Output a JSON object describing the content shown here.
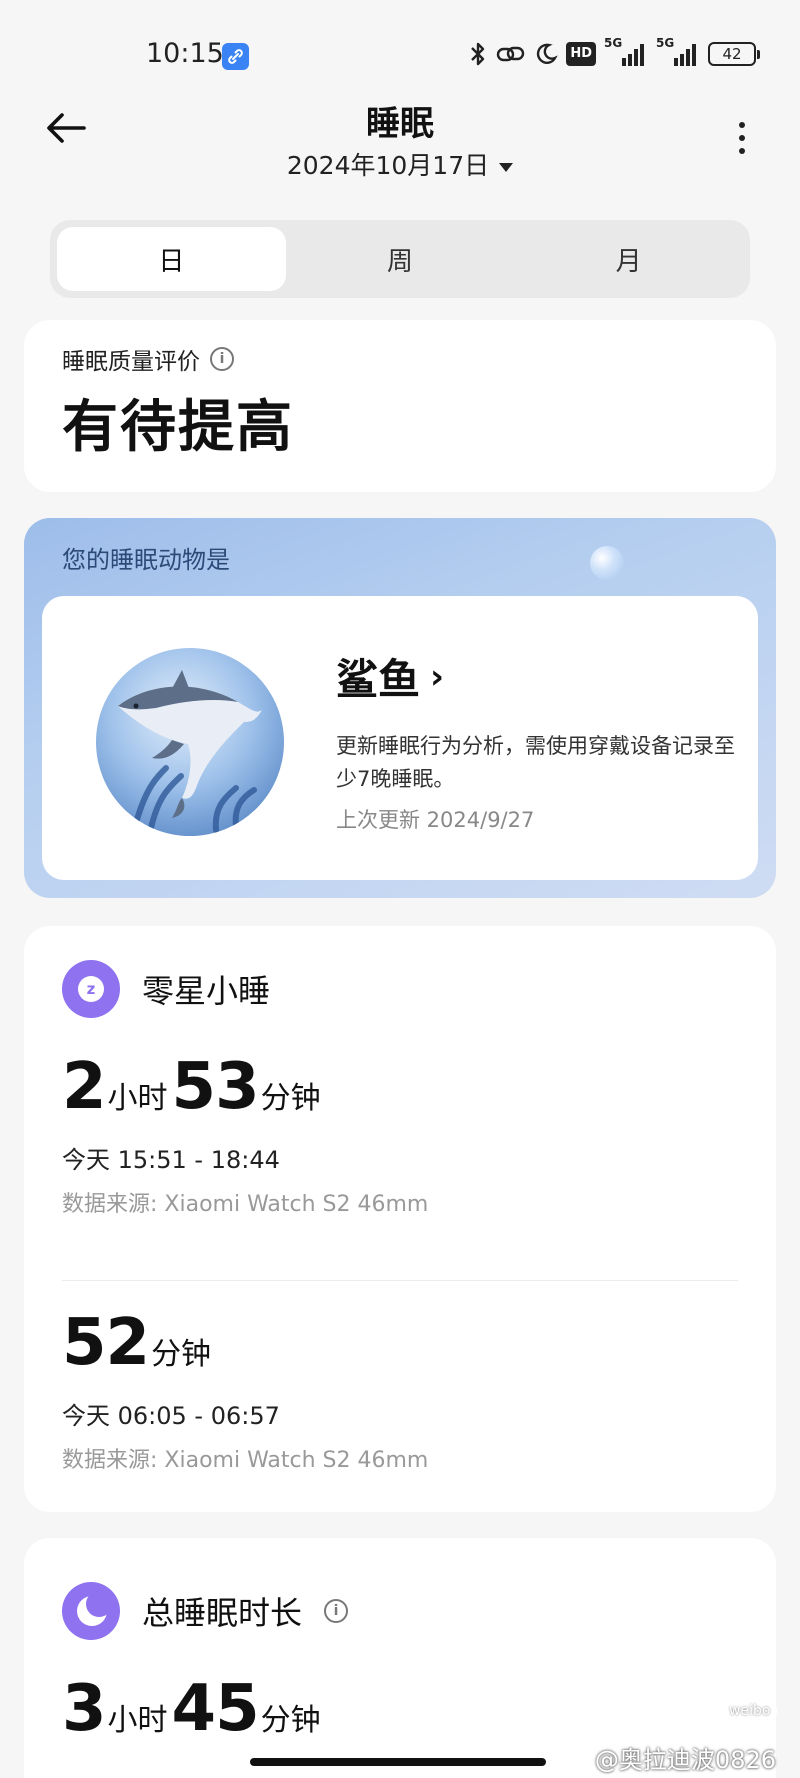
{
  "status_bar": {
    "time": "10:15",
    "hd": "HD",
    "net1": "5G",
    "net2": "5G",
    "battery": "42"
  },
  "header": {
    "title": "睡眠",
    "date": "2024年10月17日"
  },
  "tabs": [
    {
      "label": "日",
      "active": true
    },
    {
      "label": "周",
      "active": false
    },
    {
      "label": "月",
      "active": false
    }
  ],
  "quality": {
    "label": "睡眠质量评价",
    "info_icon": "i",
    "value": "有待提高"
  },
  "animal": {
    "heading": "您的睡眠动物是",
    "name": "鲨鱼",
    "chevron": "›",
    "description": "更新睡眠行为分析，需使用穿戴设备记录至少7晚睡眠。",
    "last_update": "上次更新 2024/9/27"
  },
  "naps": {
    "title": "零星小睡",
    "icon_letter": "z",
    "items": [
      {
        "hours": "2",
        "hours_unit": "小时",
        "minutes": "53",
        "minutes_unit": "分钟",
        "range": "今天 15:51 - 18:44",
        "source": "数据来源: Xiaomi Watch S2 46mm"
      },
      {
        "minutes": "52",
        "minutes_unit": "分钟",
        "range": "今天 06:05 - 06:57",
        "source": "数据来源: Xiaomi Watch S2 46mm"
      }
    ]
  },
  "total": {
    "title": "总睡眠时长",
    "info_icon": "i",
    "hours": "3",
    "hours_unit": "小时",
    "minutes": "45",
    "minutes_unit": "分钟"
  },
  "watermark": {
    "text": "@奥拉迪波0826",
    "logo": "weibo"
  },
  "colors": {
    "accent_purple": "#8e72f0",
    "status_blue": "#3a83f4",
    "page_bg": "#f6f6f6"
  }
}
